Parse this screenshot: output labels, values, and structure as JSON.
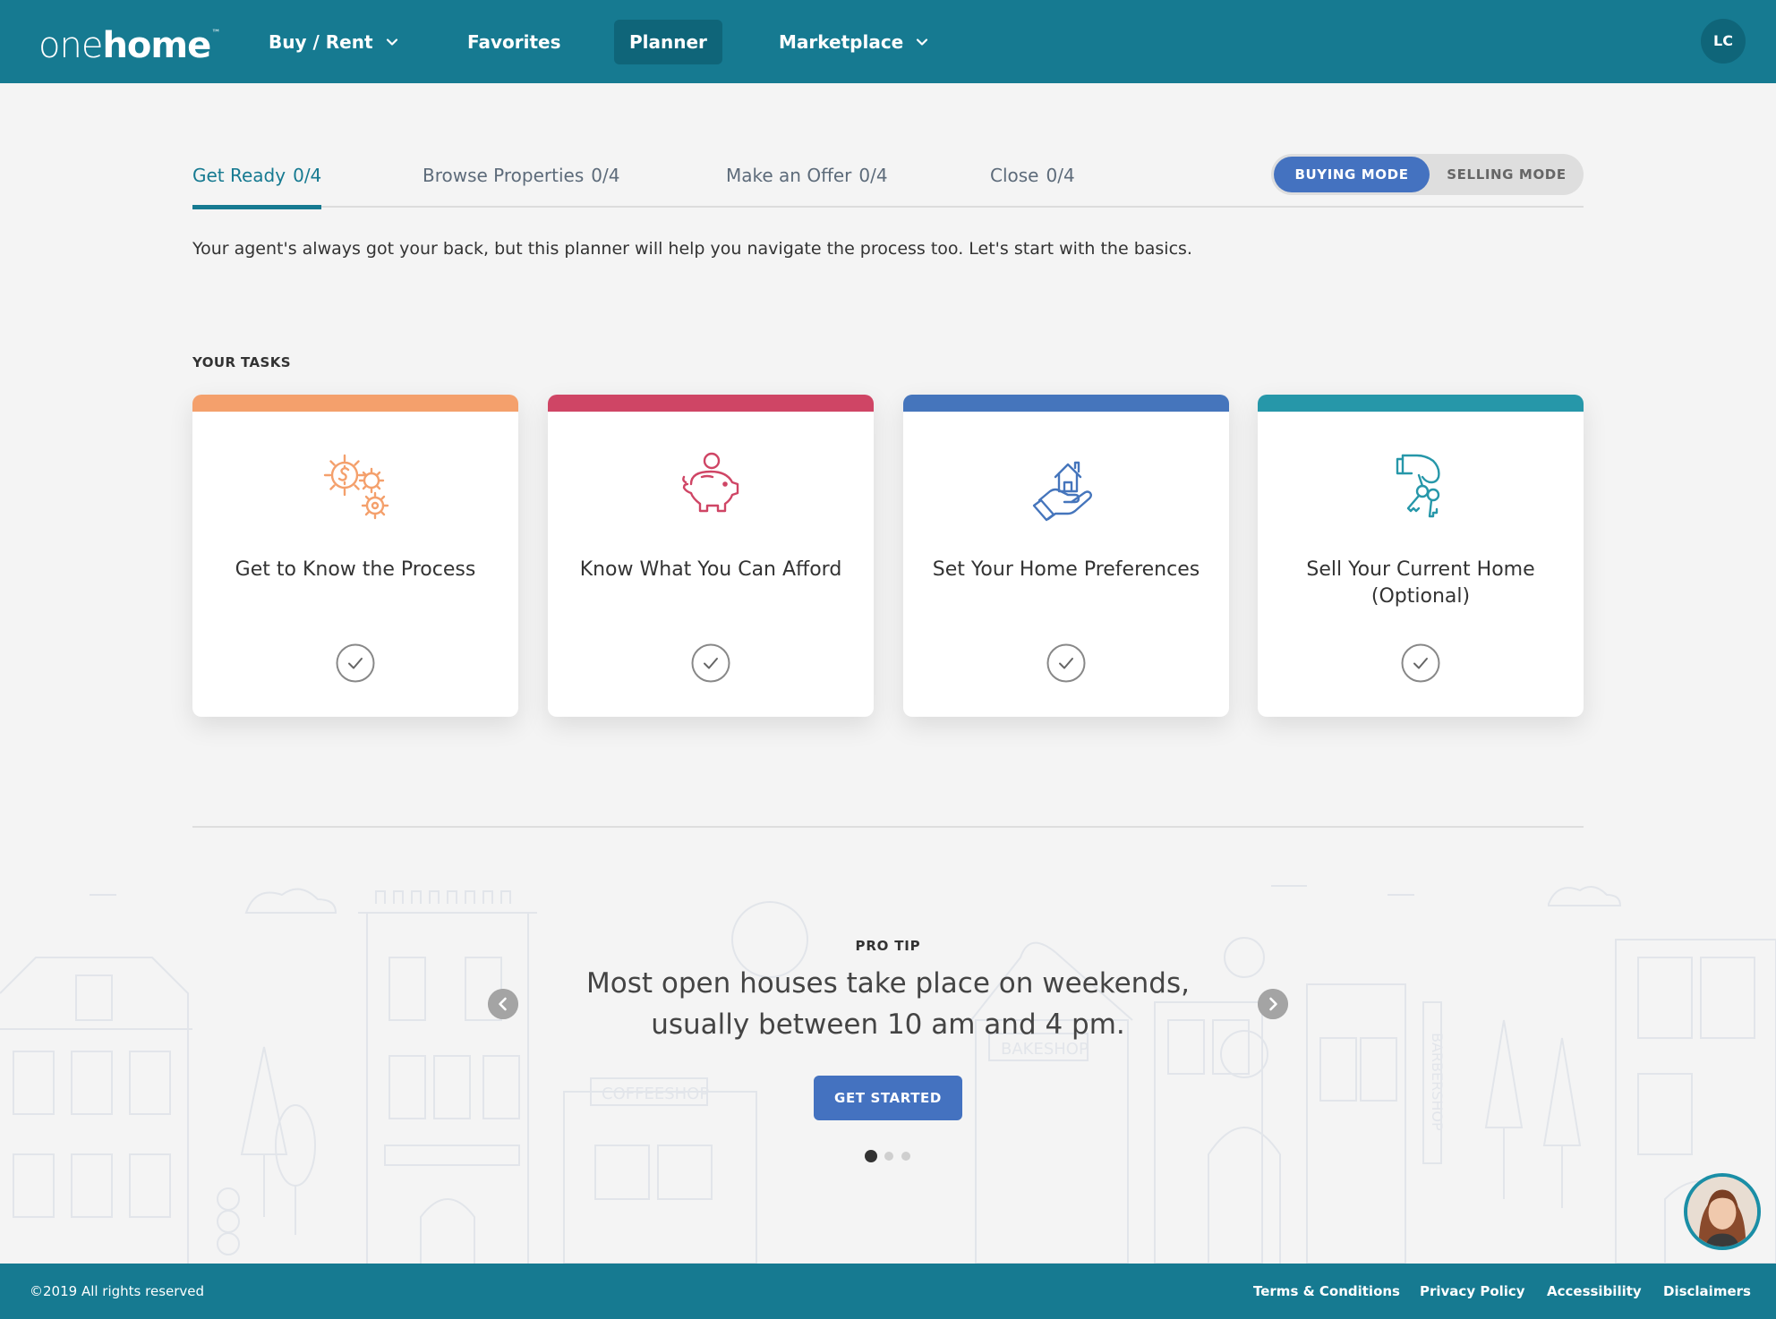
{
  "header": {
    "logo": {
      "one": "one",
      "home": "home",
      "tm": "™"
    },
    "nav": {
      "buy_rent": "Buy / Rent",
      "favorites": "Favorites",
      "planner": "Planner",
      "marketplace": "Marketplace"
    },
    "avatar_initials": "LC"
  },
  "steps": [
    {
      "label": "Get Ready",
      "count": "0/4"
    },
    {
      "label": "Browse Properties",
      "count": "0/4"
    },
    {
      "label": "Make an Offer",
      "count": "0/4"
    },
    {
      "label": "Close",
      "count": "0/4"
    }
  ],
  "mode": {
    "buying": "BUYING MODE",
    "selling": "SELLING MODE"
  },
  "intro": "Your agent's always got your back, but this planner will help you navigate the process too. Let's start with the basics.",
  "tasks_label": "YOUR TASKS",
  "tasks": [
    {
      "title": "Get to Know the Process",
      "color": "#f4a06c",
      "icon": "gears-dollar-icon"
    },
    {
      "title": "Know What You Can Afford",
      "color": "#cf4565",
      "icon": "piggy-bank-icon"
    },
    {
      "title": "Set Your Home Preferences",
      "color": "#4575bc",
      "icon": "house-in-hand-icon"
    },
    {
      "title": "Sell Your Current Home (Optional)",
      "color": "#2697a9",
      "icon": "hand-keys-icon"
    }
  ],
  "pro_tip": {
    "label": "PRO TIP",
    "text": "Most open houses take place on weekends, usually between 10 am and 4 pm.",
    "button": "GET STARTED"
  },
  "footer": {
    "copyright": "©2019 All rights reserved",
    "links": {
      "terms": "Terms & Conditions",
      "privacy": "Privacy Policy",
      "accessibility": "Accessibility",
      "disclaimers": "Disclaimers"
    }
  },
  "colors": {
    "header": "#167a91",
    "primary_button": "#4472c0",
    "background": "#f4f4f4"
  }
}
